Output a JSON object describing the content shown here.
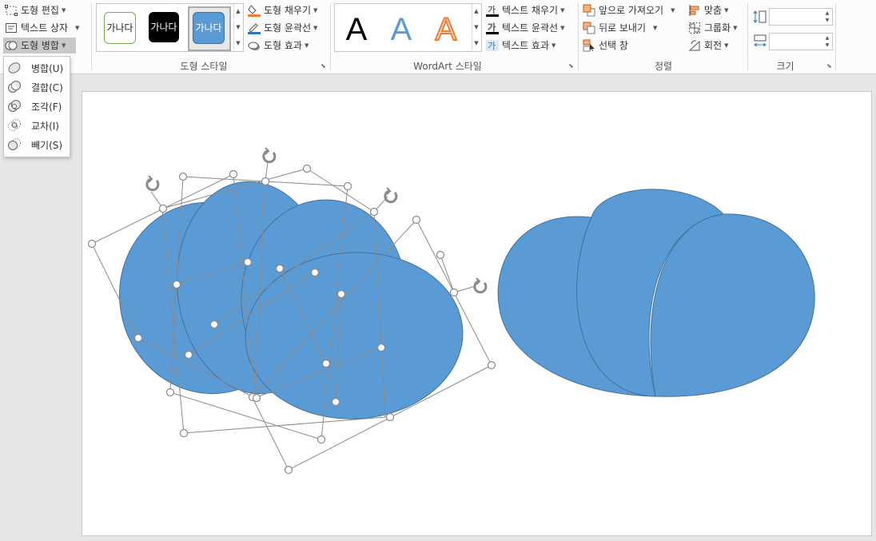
{
  "ribbon": {
    "insert_shapes": {
      "edit_shape": "도형 편집",
      "text_box": "텍스트 상자",
      "merge_shapes": "도형 병합"
    },
    "shape_styles": {
      "label": "도형 스타일",
      "thumbnails": [
        "가나다",
        "가나다",
        "가나다"
      ],
      "fill": "도형 채우기",
      "outline": "도형 윤곽선",
      "effects": "도형 효과"
    },
    "wordart_styles": {
      "label": "WordArt 스타일",
      "samples": [
        "A",
        "A",
        "A"
      ],
      "text_fill": "텍스트 채우기",
      "text_outline": "텍스트 윤곽선",
      "text_effects": "텍스트 효과"
    },
    "arrange": {
      "label": "정렬",
      "bring_forward": "앞으로 가져오기",
      "send_backward": "뒤로 보내기",
      "selection_pane": "선택 창",
      "align": "맞춤",
      "group": "그룹화",
      "rotate": "회전"
    },
    "size": {
      "label": "크기",
      "height_value": "",
      "width_value": ""
    }
  },
  "merge_menu": {
    "items": [
      {
        "label": "병합(U)",
        "icon": "union-icon"
      },
      {
        "label": "결합(C)",
        "icon": "combine-icon"
      },
      {
        "label": "조각(F)",
        "icon": "fragment-icon"
      },
      {
        "label": "교차(I)",
        "icon": "intersect-icon"
      },
      {
        "label": "빼기(S)",
        "icon": "subtract-icon"
      }
    ]
  },
  "colors": {
    "shape_fill": "#5b9bd5",
    "shape_stroke": "#41719c",
    "accent_orange": "#ed7d31"
  }
}
